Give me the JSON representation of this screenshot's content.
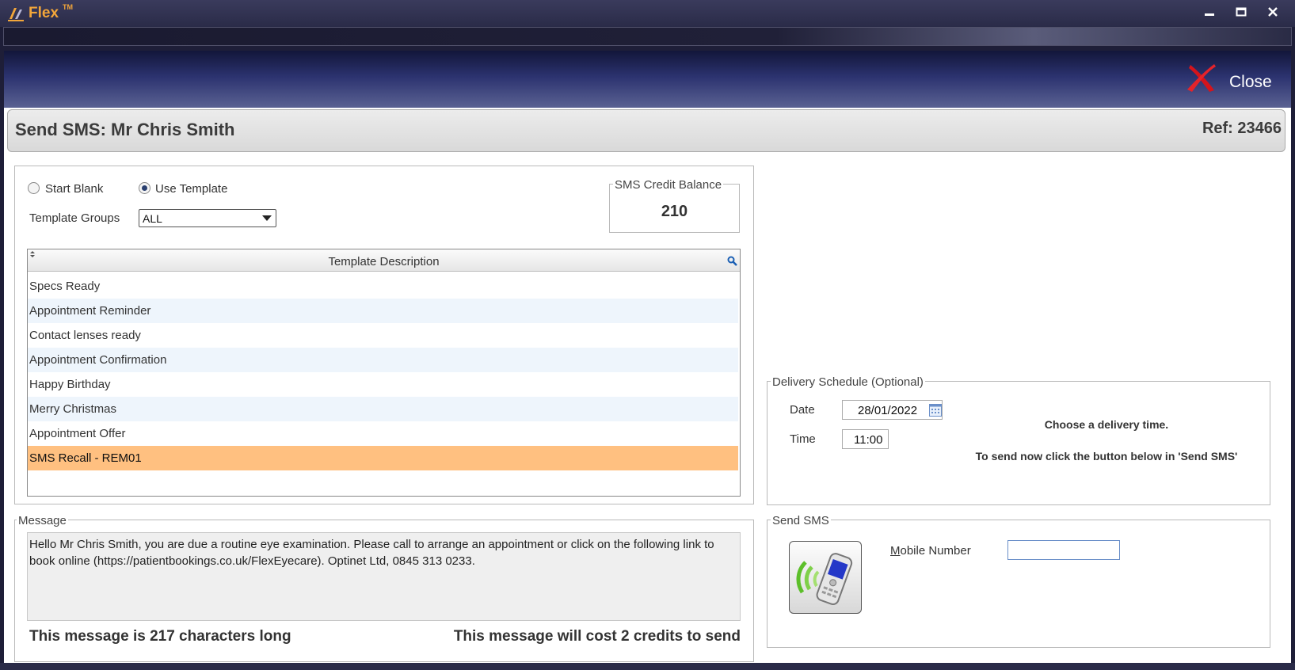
{
  "window": {
    "app_name": "Flex",
    "tm": "TM",
    "controls": [
      "minimize",
      "maximize",
      "close"
    ]
  },
  "header": {
    "close_label": "Close",
    "close_icon": "red-x-icon"
  },
  "page": {
    "title": "Send SMS: Mr Chris Smith",
    "ref": "Ref: 23466"
  },
  "template_panel": {
    "radio_blank": "Start Blank",
    "radio_template": "Use Template",
    "selected_mode": "Use Template",
    "groups_label": "Template Groups",
    "groups_value": "ALL",
    "credit_legend": "SMS Credit Balance",
    "credit_value": "210",
    "grid_header": "Template Description",
    "templates": [
      "Specs Ready",
      "Appointment Reminder",
      "Contact lenses ready",
      "Appointment Confirmation",
      "Happy Birthday",
      "Merry Christmas",
      "Appointment Offer",
      "SMS Recall - REM01"
    ],
    "selected_template": "SMS Recall - REM01"
  },
  "message": {
    "legend": "Message",
    "text": "Hello Mr Chris Smith, you are due a routine eye examination. Please call to arrange an appointment or click on the following link to book online (https://patientbookings.co.uk/FlexEyecare). Optinet Ltd, 0845 313 0233.",
    "length_note": "This message is 217 characters long",
    "cost_note": "This message will cost 2 credits to send"
  },
  "delivery": {
    "legend": "Delivery Schedule (Optional)",
    "date_label": "Date",
    "date_value": "28/01/2022",
    "time_label": "Time",
    "time_value": "11:00",
    "hint_1": "Choose a delivery time.",
    "hint_2": "To send now click the button below in 'Send SMS'"
  },
  "send": {
    "legend": "Send SMS",
    "mobile_label_m": "M",
    "mobile_label_rest": "obile Number",
    "mobile_value": ""
  },
  "colors": {
    "accent_orange": "#f2a63a",
    "selected_row": "#ffc080",
    "header_dark": "#12163a"
  }
}
